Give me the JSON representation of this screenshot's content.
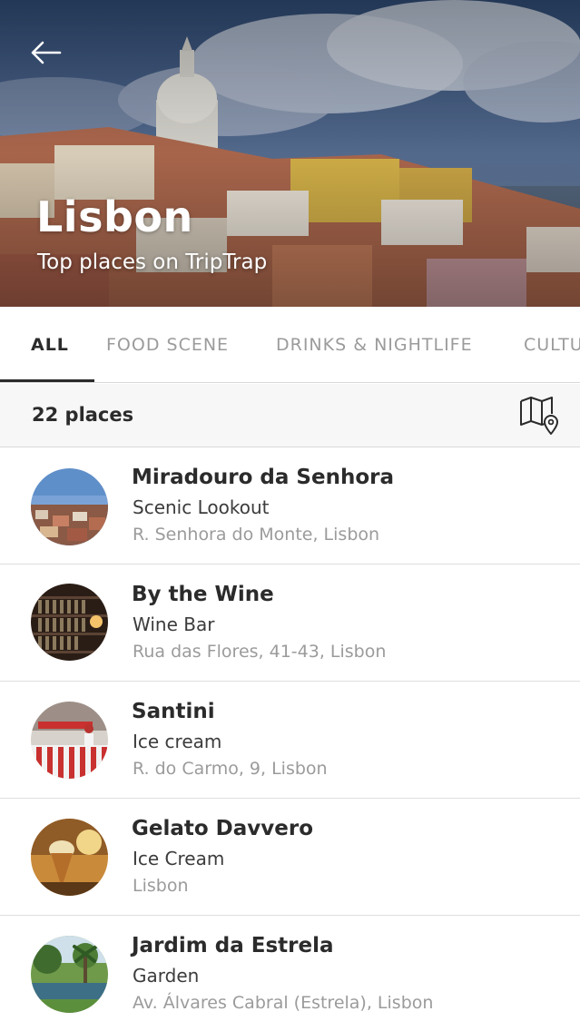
{
  "header": {
    "city": "Lisbon",
    "subtitle": "Top places on TripTrap",
    "back_icon": "arrow-left-icon"
  },
  "tabs": [
    {
      "label": "ALL",
      "active": true
    },
    {
      "label": "FOOD SCENE",
      "active": false
    },
    {
      "label": "DRINKS & NIGHTLIFE",
      "active": false
    },
    {
      "label": "CULTU",
      "active": false
    }
  ],
  "summary": {
    "count_label": "22 places",
    "map_icon": "map-pin-icon"
  },
  "places": [
    {
      "name": "Miradouro da Senhora",
      "category": "Scenic Lookout",
      "address": "R. Senhora do Monte, Lisbon",
      "thumb": "city-view"
    },
    {
      "name": "By the Wine",
      "category": "Wine Bar",
      "address": "Rua das Flores, 41-43, Lisbon",
      "thumb": "wine-shelves"
    },
    {
      "name": "Santini",
      "category": "Ice cream",
      "address": "R. do Carmo, 9, Lisbon",
      "thumb": "ice-cream-shop"
    },
    {
      "name": "Gelato Davvero",
      "category": "Ice Cream",
      "address": "Lisbon",
      "thumb": "gelato-cone"
    },
    {
      "name": "Jardim da Estrela",
      "category": "Garden",
      "address": "Av. Álvares Cabral (Estrela), Lisbon",
      "thumb": "garden-pond"
    }
  ]
}
